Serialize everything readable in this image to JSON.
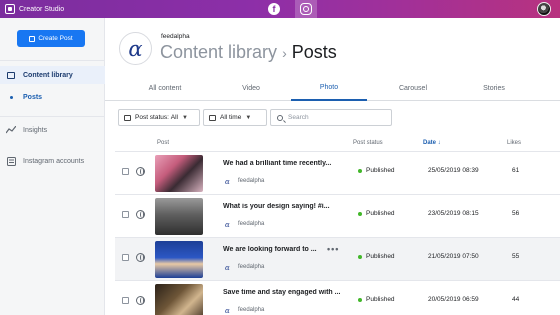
{
  "topbar": {
    "app_name": "Creator Studio",
    "facebook_label": "f"
  },
  "sidebar": {
    "create_post": "Create Post",
    "items": [
      {
        "label": "Content library"
      },
      {
        "label": "Posts"
      },
      {
        "label": "Insights"
      },
      {
        "label": "Instagram accounts"
      }
    ]
  },
  "header": {
    "account_name": "feedalpha",
    "logo_glyph": "α",
    "breadcrumb_root": "Content library",
    "breadcrumb_sep": "›",
    "breadcrumb_current": "Posts"
  },
  "tabs": [
    "All content",
    "Video",
    "Photo",
    "Carousel",
    "Stories"
  ],
  "selected_tab": "Photo",
  "filters": {
    "post_status_label": "Post status:",
    "post_status_value": "All",
    "time_value": "All time",
    "search_placeholder": "Search"
  },
  "table": {
    "columns": {
      "post": "Post",
      "status": "Post status",
      "date": "Date ↓",
      "likes": "Likes"
    },
    "rows": [
      {
        "title": "We had a brilliant time recently...",
        "account": "feedalpha",
        "status": "Published",
        "date": "25/05/2019 08:39",
        "likes": "61"
      },
      {
        "title": "What is your design saying!   #i...",
        "account": "feedalpha",
        "status": "Published",
        "date": "23/05/2019 08:15",
        "likes": "56"
      },
      {
        "title": "We are looking forward to ...",
        "account": "feedalpha",
        "status": "Published",
        "date": "21/05/2019 07:50",
        "likes": "55"
      },
      {
        "title": "Save time and stay engaged with ...",
        "account": "feedalpha",
        "status": "Published",
        "date": "20/05/2019 06:59",
        "likes": "44"
      }
    ]
  },
  "colors": {
    "accent": "#1c5fb0",
    "topbar_start": "#7b2d9e",
    "topbar_end": "#b8327f",
    "published": "#42b72a"
  }
}
